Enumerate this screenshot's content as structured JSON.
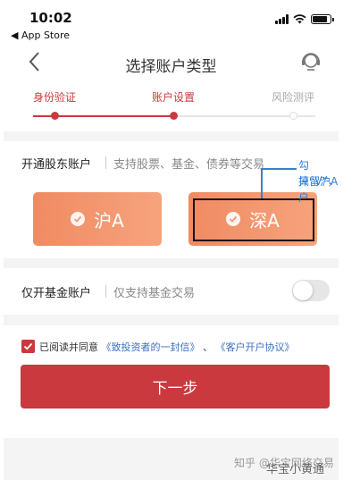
{
  "status_bar": {
    "time": "10:02",
    "back_app": "◀ App Store",
    "battery_level": 0.85
  },
  "nav": {
    "title": "选择账户类型"
  },
  "steps": [
    {
      "label": "身份验证",
      "state": "done"
    },
    {
      "label": "账户设置",
      "state": "current"
    },
    {
      "label": "风险测评",
      "state": "todo"
    }
  ],
  "stock_account": {
    "title": "开通股东账户",
    "subtitle": "支持股票、基金、债券等交易",
    "options": [
      {
        "label": "沪A",
        "selected": true
      },
      {
        "label": "深A",
        "selected": true
      }
    ]
  },
  "annotation": {
    "line1": "勾掉“V”，",
    "line2": "只留沪A户"
  },
  "fund_account": {
    "title": "仅开基金账户",
    "subtitle": "仅支持基金交易",
    "enabled": false
  },
  "agreement": {
    "checked": true,
    "prefix": "已阅读并同意",
    "link1": "《致投资者的一封信》",
    "sep": "、",
    "link2": "《客户开户协议》"
  },
  "next_button": "下一步",
  "watermark": {
    "text": "知乎 @华宝网络交易",
    "overlay": "华宝小黄通"
  },
  "colors": {
    "accent": "#c9393d",
    "button_gradient_start": "#f08b63",
    "button_gradient_end": "#f6a37c",
    "annotation": "#2f7fd6"
  }
}
